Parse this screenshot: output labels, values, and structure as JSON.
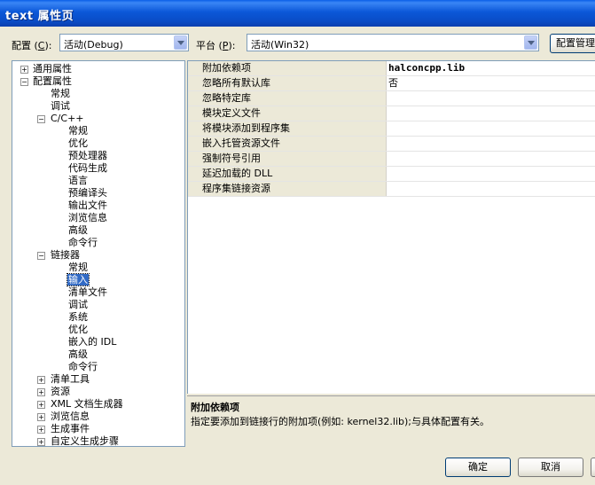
{
  "window": {
    "title": "text 属性页"
  },
  "toolbar": {
    "config_label_prefix": "配置 (",
    "config_label_key": "C",
    "config_label_suffix": "):",
    "config_value": "活动(Debug)",
    "platform_label_prefix": "平台 (",
    "platform_label_key": "P",
    "platform_label_suffix": "):",
    "platform_value": "活动(Win32)",
    "config_manager_label": "配置管理器"
  },
  "tree": {
    "common": "通用属性",
    "config_props": "配置属性",
    "general": "常规",
    "debugging": "调试",
    "cpp": "C/C++",
    "cpp_items": [
      "常规",
      "优化",
      "预处理器",
      "代码生成",
      "语言",
      "预编译头",
      "输出文件",
      "浏览信息",
      "高级",
      "命令行"
    ],
    "linker": "链接器",
    "linker_items": [
      "常规",
      "输入",
      "清单文件",
      "调试",
      "系统",
      "优化",
      "嵌入的 IDL",
      "高级",
      "命令行"
    ],
    "bottom_items": [
      "清单工具",
      "资源",
      "XML 文档生成器",
      "浏览信息",
      "生成事件",
      "自定义生成步骤"
    ]
  },
  "properties": [
    {
      "name": "附加依赖项",
      "value": "halconcpp.lib"
    },
    {
      "name": "忽略所有默认库",
      "value": "否"
    },
    {
      "name": "忽略特定库",
      "value": ""
    },
    {
      "name": "模块定义文件",
      "value": ""
    },
    {
      "name": "将模块添加到程序集",
      "value": ""
    },
    {
      "name": "嵌入托管资源文件",
      "value": ""
    },
    {
      "name": "强制符号引用",
      "value": ""
    },
    {
      "name": "延迟加载的 DLL",
      "value": ""
    },
    {
      "name": "程序集链接资源",
      "value": ""
    }
  ],
  "description": {
    "title": "附加依赖项",
    "text": "指定要添加到链接行的附加项(例如: kernel32.lib);与具体配置有关。"
  },
  "buttons": {
    "ok": "确定",
    "cancel": "取消"
  }
}
